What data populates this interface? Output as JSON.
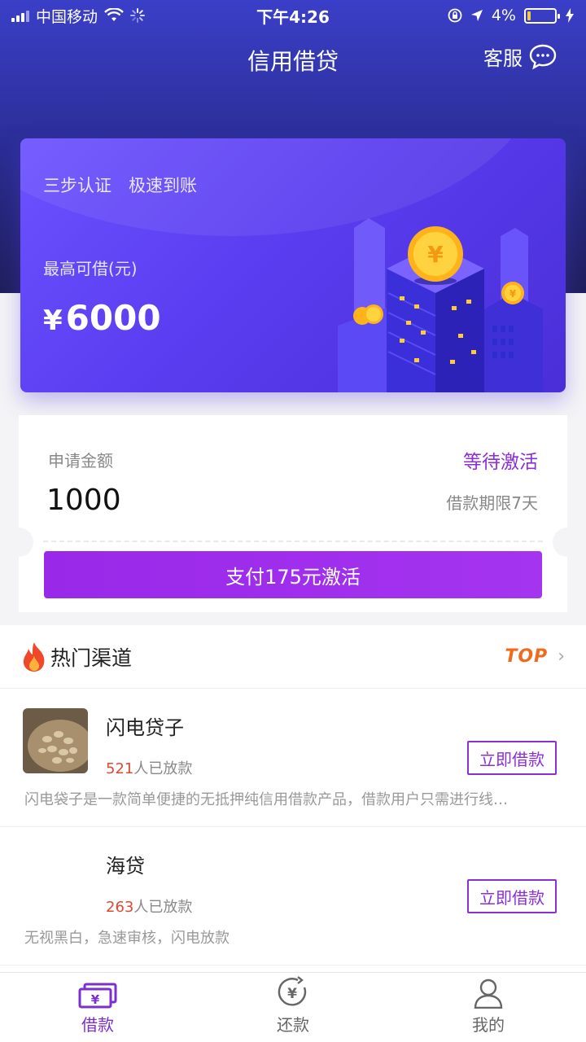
{
  "status_bar": {
    "carrier": "中国移动",
    "time": "下午4:26",
    "battery": "4%"
  },
  "nav": {
    "title": "信用借贷",
    "service": "客服"
  },
  "hero": {
    "subtitle": "三步认证　极速到账",
    "label": "最高可借(元)",
    "currency": "¥",
    "amount": "6000"
  },
  "apply": {
    "label": "申请金额",
    "status": "等待激活",
    "amount": "1000",
    "term": "借款期限7天",
    "button": "支付175元激活"
  },
  "hot": {
    "title": "热门渠道",
    "badge": "TOP",
    "channels": [
      {
        "name": "闪电贷子",
        "count": "521",
        "count_suffix": "人已放款",
        "desc": "闪电袋子是一款简单便捷的无抵押纯信用借款产品，借款用户只需进行线…",
        "button": "立即借款"
      },
      {
        "name": "海贷",
        "count": "263",
        "count_suffix": "人已放款",
        "desc": "无视黑白，急速审核，闪电放款",
        "button": "立即借款"
      }
    ]
  },
  "tabs": [
    {
      "label": "借款",
      "icon": "loan-icon",
      "active": true
    },
    {
      "label": "还款",
      "icon": "repay-icon",
      "active": false
    },
    {
      "label": "我的",
      "icon": "profile-icon",
      "active": false
    }
  ],
  "colors": {
    "accent": "#8b2fd6",
    "header": "#3b3fc8",
    "count": "#e2472f",
    "top": "#f06a1b"
  }
}
